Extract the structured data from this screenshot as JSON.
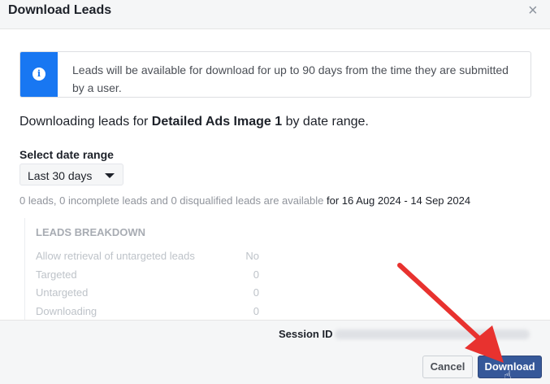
{
  "dialog": {
    "title": "Download Leads",
    "close_glyph": "×"
  },
  "info": {
    "icon": "info-icon",
    "glyph": "i",
    "text": "Leads will be available for download for up to 90 days from the time they are submitted by a user."
  },
  "summary": {
    "prefix": "Downloading leads for ",
    "ad_name": "Detailed Ads Image 1",
    "suffix": " by date range."
  },
  "date_range": {
    "label": "Select date range",
    "selected": "Last 30 days"
  },
  "availability": {
    "text": "0 leads, 0 incomplete leads and 0 disqualified leads are available",
    "range": " for 16 Aug 2024 - 14 Sep 2024"
  },
  "breakdown": {
    "title": "LEADS BREAKDOWN",
    "rows": [
      {
        "label": "Allow retrieval of untargeted leads",
        "value": "No"
      },
      {
        "label": "Targeted",
        "value": "0"
      },
      {
        "label": "Untargeted",
        "value": "0"
      },
      {
        "label": "Downloading",
        "value": "0"
      }
    ]
  },
  "footer": {
    "session_label": "Session ID",
    "cancel_label": "Cancel",
    "download_label": "Download"
  },
  "colors": {
    "accent": "#1877f2",
    "primary_button": "#365899",
    "annotation_arrow": "#e8322f"
  }
}
